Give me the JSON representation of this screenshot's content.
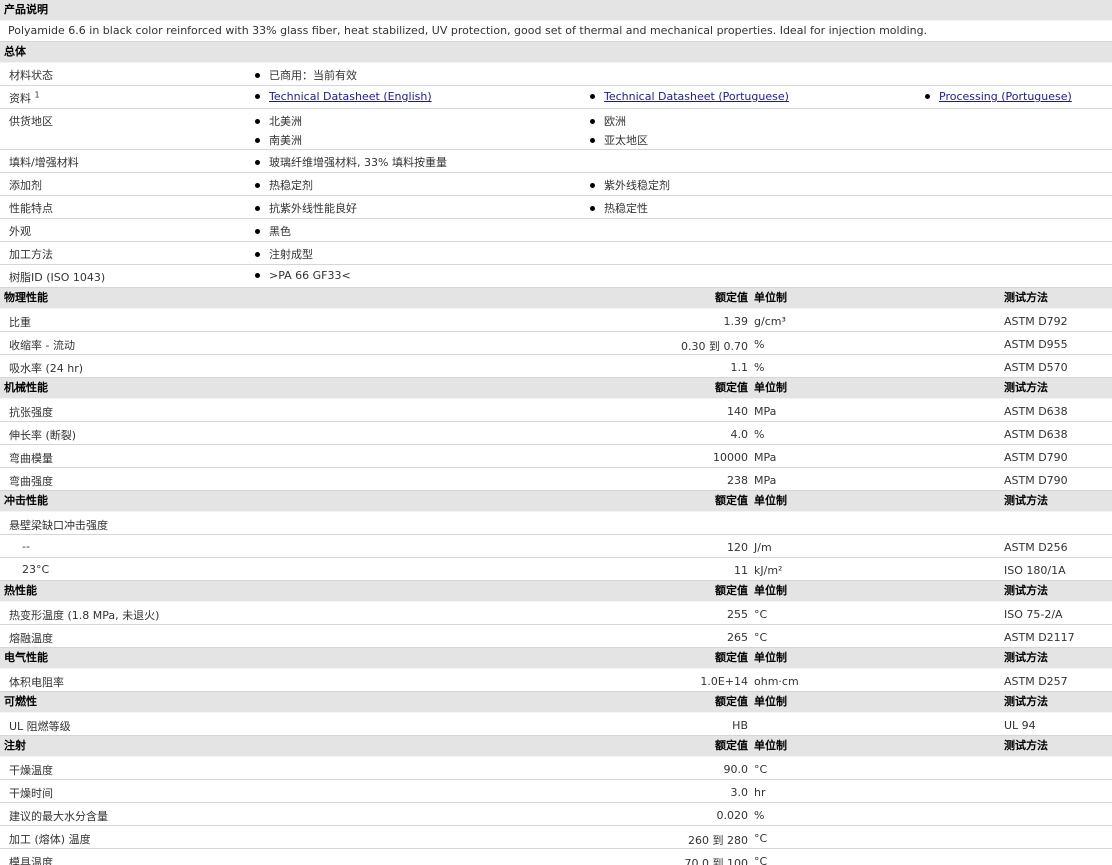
{
  "product_description": {
    "title": "产品说明",
    "text": "Polyamide 6.6 in black color reinforced with 33% glass fiber, heat stabilized, UV protection, good set of thermal and mechanical properties. Ideal for injection molding."
  },
  "general": {
    "title": "总体",
    "material_status": {
      "label": "材料状态",
      "values": [
        "已商用：当前有效"
      ]
    },
    "literature": {
      "label": "资料",
      "sup": "1",
      "links": [
        "Technical Datasheet (English)",
        "Technical Datasheet (Portuguese)",
        "Processing (Portuguese)"
      ]
    },
    "availability": {
      "label": "供货地区",
      "values": [
        "北美洲",
        "欧洲",
        "南美洲",
        "亚太地区"
      ]
    },
    "filler": {
      "label": "填料/增强材料",
      "values": [
        "玻璃纤维增强材料, 33% 填料按重量"
      ]
    },
    "additive": {
      "label": "添加剂",
      "values": [
        "热稳定剂",
        "紫外线稳定剂"
      ]
    },
    "features": {
      "label": "性能特点",
      "values": [
        "抗紫外线性能良好",
        "热稳定性"
      ]
    },
    "appearance": {
      "label": "外观",
      "values": [
        "黑色"
      ]
    },
    "processing": {
      "label": "加工方法",
      "values": [
        "注射成型"
      ]
    },
    "resin_id": {
      "label": "树脂ID (ISO 1043)",
      "values": [
        ">PA 66 GF33<"
      ]
    }
  },
  "headers": {
    "nominal": "额定值",
    "unit": "单位制",
    "test": "测试方法"
  },
  "physical": {
    "title": "物理性能",
    "rows": [
      {
        "label": "比重",
        "nom": "1.39",
        "unit": "g/cm³",
        "test": "ASTM D792"
      },
      {
        "label": "收缩率 - 流动",
        "nom": "0.30 到  0.70",
        "unit": "%",
        "test": "ASTM D955"
      },
      {
        "label": "吸水率 (24 hr)",
        "nom": "1.1",
        "unit": "%",
        "test": "ASTM D570"
      }
    ]
  },
  "mechanical": {
    "title": "机械性能",
    "rows": [
      {
        "label": "抗张强度",
        "nom": "140",
        "unit": "MPa",
        "test": "ASTM D638"
      },
      {
        "label": "伸长率 (断裂)",
        "nom": "4.0",
        "unit": "%",
        "test": "ASTM D638"
      },
      {
        "label": "弯曲模量",
        "nom": "10000",
        "unit": "MPa",
        "test": "ASTM D790"
      },
      {
        "label": "弯曲强度",
        "nom": "238",
        "unit": "MPa",
        "test": "ASTM D790"
      }
    ]
  },
  "impact": {
    "title": "冲击性能",
    "rows": [
      {
        "label": "悬壁梁缺口冲击强度",
        "nom": "",
        "unit": "",
        "test": ""
      },
      {
        "label": "--",
        "nom": "120",
        "unit": "J/m",
        "test": "ASTM D256"
      },
      {
        "label": "23°C",
        "nom": "11",
        "unit": "kJ/m²",
        "test": "ISO 180/1A"
      }
    ]
  },
  "thermal": {
    "title": "热性能",
    "rows": [
      {
        "label": "热变形温度 (1.8 MPa, 未退火)",
        "nom": "255",
        "unit": "°C",
        "test": "ISO 75-2/A"
      },
      {
        "label": "熔融温度",
        "nom": "265",
        "unit": "°C",
        "test": "ASTM D2117"
      }
    ]
  },
  "electrical": {
    "title": "电气性能",
    "rows": [
      {
        "label": "体积电阻率",
        "nom": "1.0E+14",
        "unit": "ohm·cm",
        "test": "ASTM D257"
      }
    ]
  },
  "flammability": {
    "title": "可燃性",
    "rows": [
      {
        "label": "UL 阻燃等级",
        "nom": "HB",
        "unit": "",
        "test": "UL 94"
      }
    ]
  },
  "injection": {
    "title": "注射",
    "rows": [
      {
        "label": "干燥温度",
        "nom": "90.0",
        "unit": "°C",
        "test": ""
      },
      {
        "label": "干燥时间",
        "nom": "3.0",
        "unit": "hr",
        "test": ""
      },
      {
        "label": "建议的最大水分含量",
        "nom": "0.020",
        "unit": "%",
        "test": ""
      },
      {
        "label": "加工 (熔体) 温度",
        "nom": "260 到  280",
        "unit": "°C",
        "test": ""
      },
      {
        "label": "模具温度",
        "nom": "70.0 到  100",
        "unit": "°C",
        "test": ""
      }
    ]
  }
}
